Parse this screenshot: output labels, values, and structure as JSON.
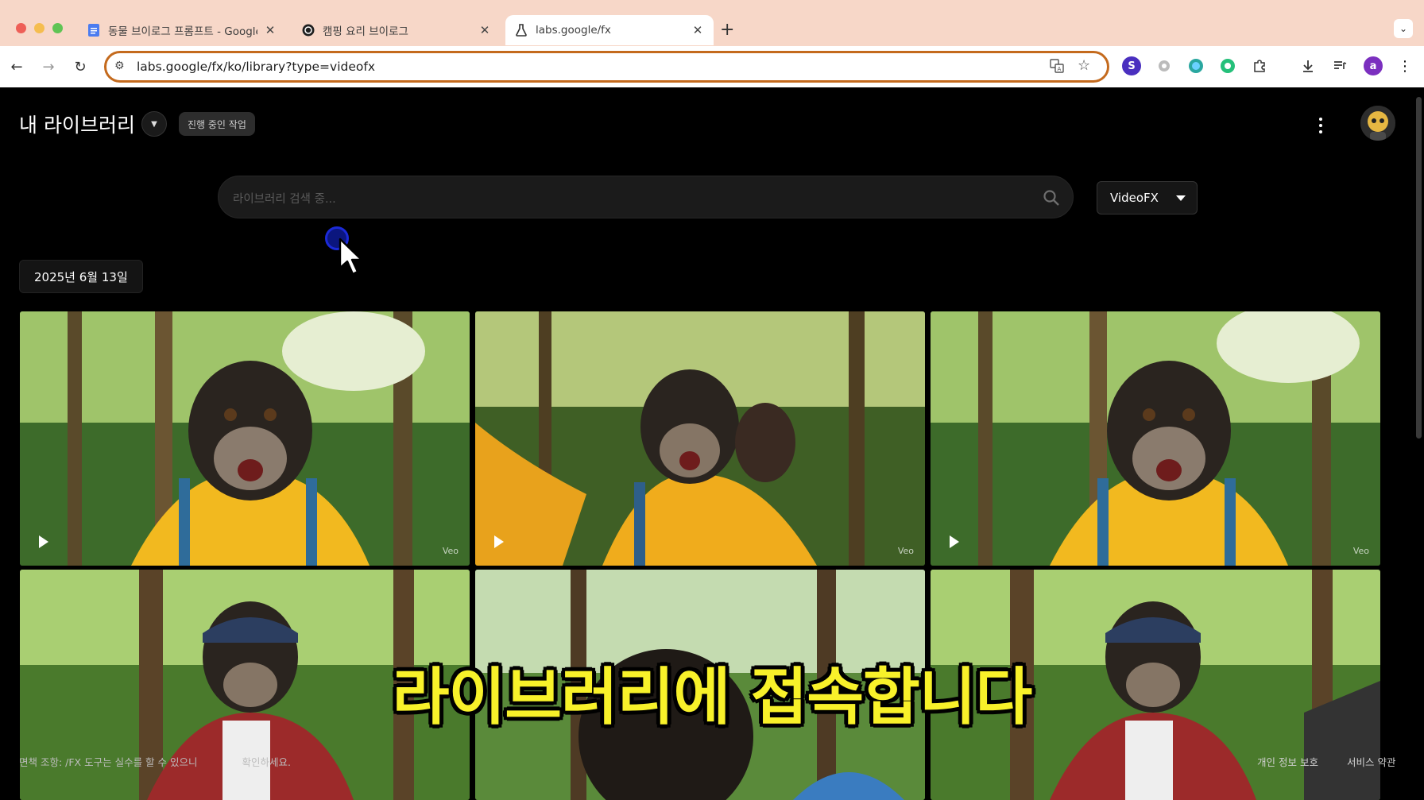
{
  "browser": {
    "tabs": [
      {
        "title": "동물 브이로그 프롬프트 - Google",
        "icon": "docs-icon",
        "active": false
      },
      {
        "title": "캠핑 요리 브이로그",
        "icon": "openai-icon",
        "active": false
      },
      {
        "title": "labs.google/fx",
        "icon": "flask-icon",
        "active": true
      }
    ],
    "url": "labs.google/fx/ko/library?type=videofx",
    "profile_initial": "a"
  },
  "header": {
    "title": "내 라이브러리",
    "progress_chip": "진행 중인 작업"
  },
  "search": {
    "placeholder": "라이브러리 검색 중..."
  },
  "filter": {
    "selected": "VideoFX"
  },
  "date_group": {
    "label": "2025년 6월 13일"
  },
  "thumbnails": [
    {
      "badge": "Veo",
      "subject": "chimpanzee-yellow-hoodie-selfie"
    },
    {
      "badge": "Veo",
      "subject": "chimpanzee-yellow-hoodie-reaching"
    },
    {
      "badge": "Veo",
      "subject": "chimpanzee-yellow-hoodie-selfie"
    },
    {
      "badge": "",
      "subject": "chimpanzee-plaid-shirt-cap"
    },
    {
      "badge": "",
      "subject": "chimpanzee-campsite"
    },
    {
      "badge": "",
      "subject": "chimpanzee-plaid-shirt-cap"
    }
  ],
  "caption": "라이브러리에 접속합니다",
  "footer": {
    "disclaimer": "면책 조항: /FX 도구는 실수를 할 수 있으니",
    "disclaimer_tail": "확인하세요.",
    "privacy": "개인 정보 보호",
    "terms": "서비스 약관"
  },
  "colors": {
    "accent_caption": "#f8f12a",
    "omnibox_border": "#c46a1d",
    "tabbar": "#f7d7c8"
  }
}
